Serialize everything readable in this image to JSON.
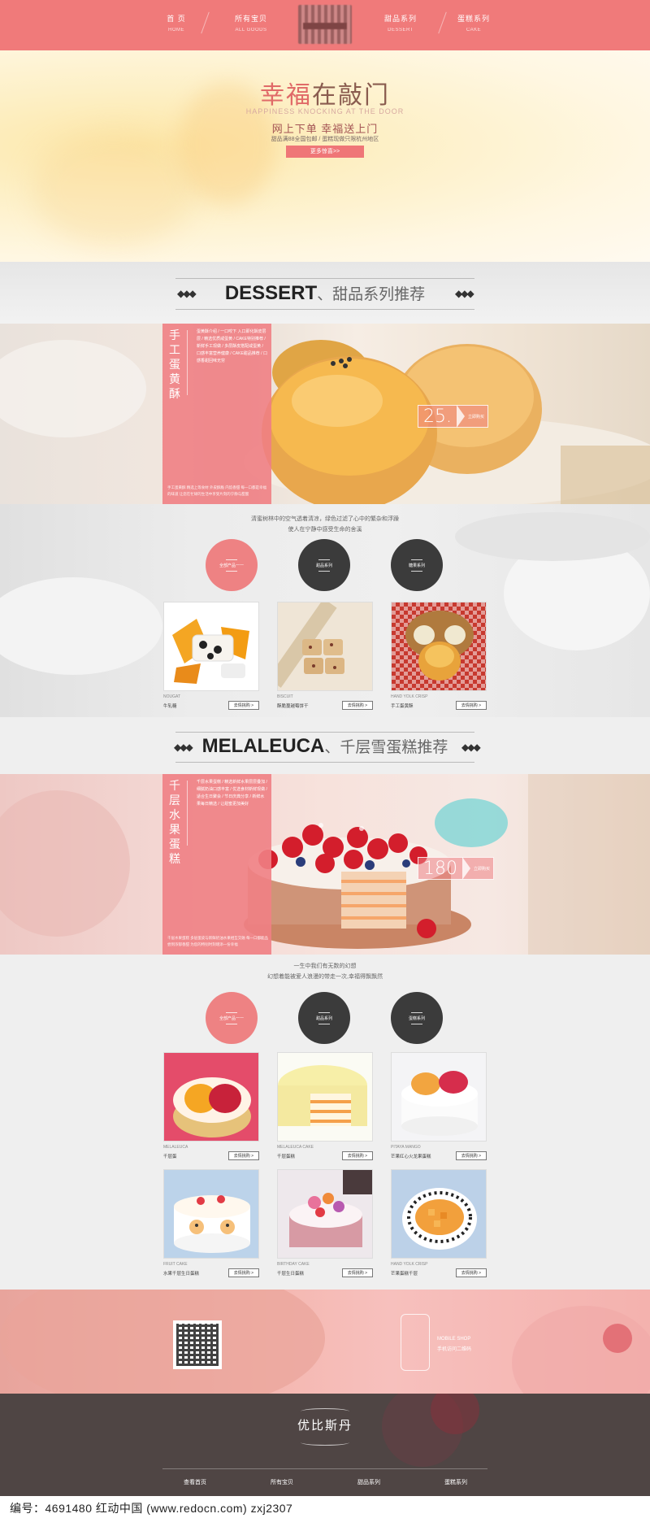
{
  "nav": {
    "items": [
      {
        "cn": "首    页",
        "en": "HOME"
      },
      {
        "cn": "所有宝贝",
        "en": "ALL GOODS"
      },
      {
        "cn": "甜品系列",
        "en": "DESSERT"
      },
      {
        "cn": "蛋糕系列",
        "en": "CAKE"
      }
    ]
  },
  "hero": {
    "title_accent": "幸福",
    "title_rest": "在敲门",
    "subtitle_en": "HAPPINESS KNOCKING AT THE DOOR",
    "slogan": "网上下单  幸福送上门",
    "sub": "甜品满88全国包邮 / 蛋糕现做只限杭州地区",
    "button": "更多惊喜>>"
  },
  "section1": {
    "title_en": "DESSERT",
    "title_cn": "、甜品系列推荐",
    "arrows_left": "◆◆◆",
    "arrows_right": "◆◆◆",
    "banner": {
      "vtitle": "手工蛋黄酥",
      "text": "蛋黄酥介绍 / 一口咬下 入口即化酥皮层层 / 精选优质咸蛋黄 / CAKE特别推荐 / 新鲜手工现做 / 多层酥皮搭配咸蛋黄 / 口感丰富营养健康 / CAKE甜品推荐 / 口感香甜回味无穷",
      "foot": "手工蛋黄酥 精选上等食材 外皮酥脆 内馅香甜 每一口都是幸福的味道 让您在忙碌的生活中享受片刻的宁静与甜蜜",
      "price": "25.",
      "price_label": "立即购买"
    },
    "intro": [
      "清蜜树林中的空气透着清凉，绿色过滤了心中的繁杂和浮躁",
      "使人在宁静中感受生命的舍溪"
    ],
    "circles": [
      "全部产品一一",
      "甜品系列",
      "糖果系列"
    ],
    "products": [
      {
        "en": "NOUGAT",
        "name": "牛轧糖",
        "btn": "去情挑购 >"
      },
      {
        "en": "BISCUIT",
        "name": "酥脆蔓越莓饼干",
        "btn": "去情挑购 >"
      },
      {
        "en": "HAND YOLK CRISP",
        "name": "手工蛋黄酥",
        "btn": "去情挑购 >"
      }
    ]
  },
  "section2": {
    "title_en": "MELALEUCA",
    "title_cn": "、千层雪蛋糕推荐",
    "arrows_left": "◆◆◆",
    "arrows_right": "◆◆◆",
    "banner": {
      "vtitle": "千层水果蛋糕",
      "text": "千层水果蛋糕 / 精选新鲜水果层层叠加 / 细腻奶油口感丰富 / 优选食材新鲜现做 / 适合生日聚会 / 节日庆典分享 / 新鲜水果每日精选 / 让甜蜜更加美好",
      "foot": "千层水果蛋糕 多层蛋皮与新鲜奶油水果相互交融 每一口都能品尝到浓郁香甜 为您的特别时刻增添一份幸福",
      "price": "180",
      "price_label": "立即购买"
    },
    "intro": [
      "一生中我们有无数的幻想",
      "幻想着能被爱人浪漫的带走一次,幸福得飘飘然"
    ],
    "circles": [
      "全部产品一一",
      "甜品系列",
      "蛋糕系列"
    ],
    "products": [
      {
        "en": "MELALEUCA",
        "name": "千层蛋",
        "btn": "去情挑购 >"
      },
      {
        "en": "MELALEUCA CAKE",
        "name": "千层蛋糕",
        "btn": "去情挑购 >"
      },
      {
        "en": "PITAYA MANGO",
        "name": "芒果红心火龙果蛋糕",
        "btn": "去情挑购 >"
      },
      {
        "en": "FRUIT CAKE",
        "name": "水果千层生日蛋糕",
        "btn": "去情挑购 >"
      },
      {
        "en": "BIRTHDAY CAKE",
        "name": "千层生日蛋糕",
        "btn": "去情挑购 >"
      },
      {
        "en": "HAND YOLK CRISP",
        "name": "芒果蛋糕千层",
        "btn": "去情挑购 >"
      }
    ]
  },
  "footer": {
    "mobile_en": "MOBILE SHOP",
    "mobile_cn": "手机访问二维码",
    "brand": "优比斯丹",
    "links": [
      "查看首页",
      "所有宝贝",
      "甜品系列",
      "蛋糕系列"
    ]
  },
  "credit": "编号：4691480   红动中国 (www.redocn.com)   zxj2307"
}
